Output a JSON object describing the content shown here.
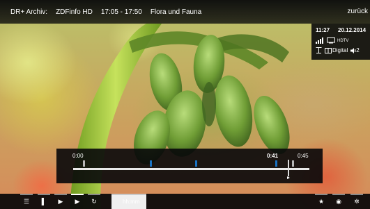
{
  "header": {
    "source": "DR+ Archiv:",
    "channel": "ZDFinfo HD",
    "time_range": "17:05 - 17:50",
    "title": "Flora und Fauna",
    "back_label": "zurück"
  },
  "info_panel": {
    "clock": "11:27",
    "date": "20.12.2014",
    "quality_tag": "HDTV",
    "signal_label": "Digital",
    "audio_channel": "2",
    "signal_icon": "signal-bars-icon",
    "screen_icon": "screen-icon",
    "antenna_icon": "antenna-icon",
    "dolby_icon": "dolby-icon",
    "speaker_icon": "speaker-icon"
  },
  "timeline": {
    "start_label": "0:00",
    "current_label": "0:41",
    "end_label": "0:45",
    "position_fraction": 0.9111,
    "gray_marks": [
      0.045,
      0.93
    ],
    "blue_marks": [
      0.33,
      0.52,
      0.86
    ]
  },
  "toolbar": {
    "buttons": [
      {
        "name": "list-icon",
        "glyph": "☰",
        "active": false
      },
      {
        "name": "bookmark-icon",
        "glyph": "▌",
        "active": false
      },
      {
        "name": "chapter-forward-icon",
        "glyph": "▶",
        "active": false
      },
      {
        "name": "chapter-jump-icon",
        "glyph": "▶",
        "active": true
      },
      {
        "name": "repeat-icon",
        "glyph": "↻",
        "active": false
      }
    ],
    "time_input_placeholder": "hh:mm",
    "right_buttons": [
      {
        "name": "favorite-icon",
        "glyph": "★"
      },
      {
        "name": "info-icon",
        "glyph": "◉"
      },
      {
        "name": "settings-icon",
        "glyph": "✲"
      }
    ]
  },
  "colors": {
    "bar_bg": "#08080a",
    "marker_blue": "#1a73c4",
    "marker_gray": "#b7b7b7",
    "track": "#e9e9e9"
  }
}
